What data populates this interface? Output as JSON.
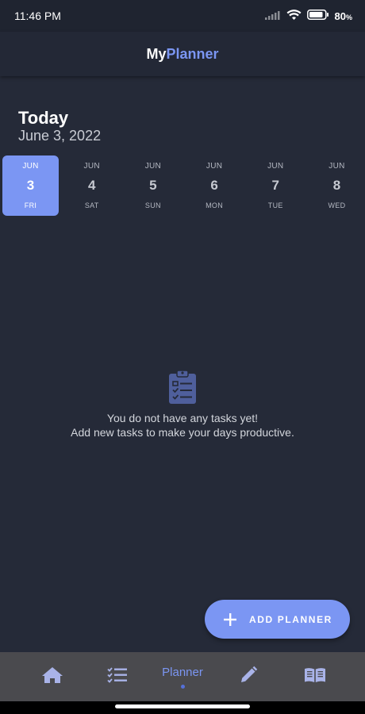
{
  "status_bar": {
    "time": "11:46 PM",
    "battery_percent": "80",
    "battery_unit": "%",
    "icons": [
      "signal-icon",
      "wifi-icon",
      "battery-icon"
    ]
  },
  "header": {
    "title_part1": "My",
    "title_part2": "Planner"
  },
  "today": {
    "heading": "Today",
    "date": "June 3, 2022"
  },
  "days": [
    {
      "month": "JUN",
      "day": "3",
      "weekday": "FRI",
      "selected": true
    },
    {
      "month": "JUN",
      "day": "4",
      "weekday": "SAT",
      "selected": false
    },
    {
      "month": "JUN",
      "day": "5",
      "weekday": "SUN",
      "selected": false
    },
    {
      "month": "JUN",
      "day": "6",
      "weekday": "MON",
      "selected": false
    },
    {
      "month": "JUN",
      "day": "7",
      "weekday": "TUE",
      "selected": false
    },
    {
      "month": "JUN",
      "day": "8",
      "weekday": "WED",
      "selected": false
    }
  ],
  "empty_state": {
    "icon": "clipboard-checklist-icon",
    "line1": "You do not have any tasks yet!",
    "line2": "Add new tasks to make your days productive."
  },
  "fab": {
    "label": "ADD PLANNER",
    "icon": "plus-icon"
  },
  "bottom_nav": {
    "items": [
      {
        "icon": "home-icon"
      },
      {
        "icon": "checklist-icon"
      },
      {
        "label": "Planner",
        "active": true
      },
      {
        "icon": "pencil-icon"
      },
      {
        "icon": "book-icon"
      }
    ]
  },
  "colors": {
    "accent": "#7b96f3",
    "background": "#252a38",
    "header_bg": "#232836",
    "nav_bg": "#4a4a4e",
    "icon_muted": "#4f5f9c"
  }
}
